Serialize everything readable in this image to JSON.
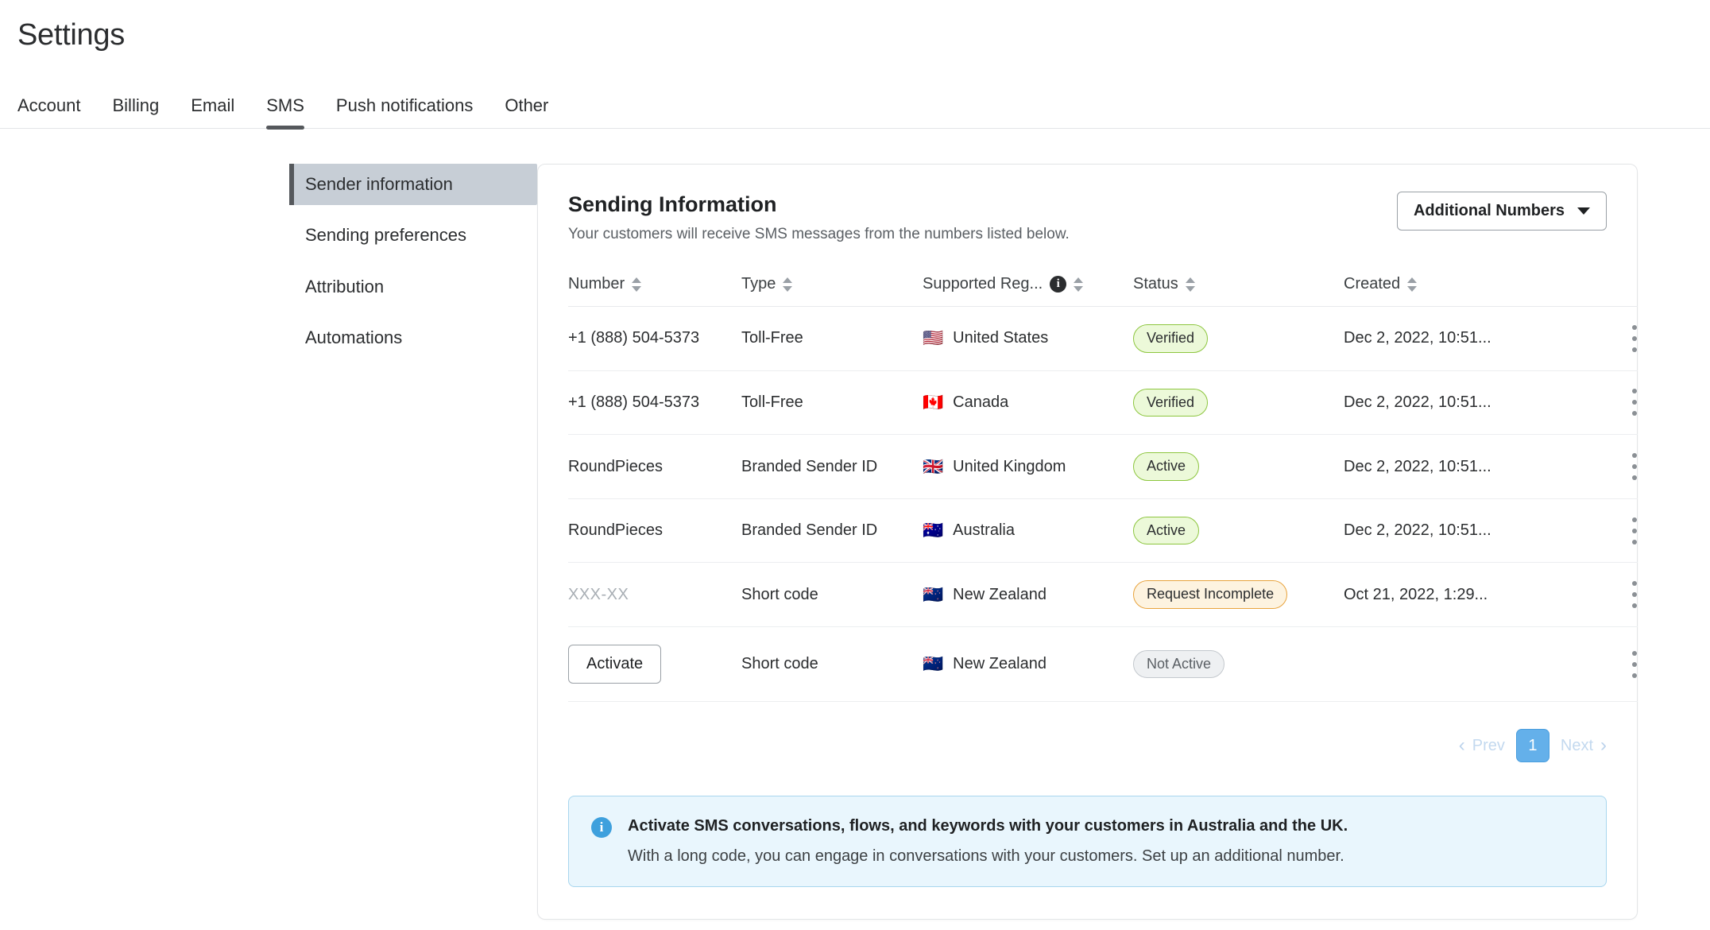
{
  "header": {
    "title": "Settings"
  },
  "tabs": [
    {
      "label": "Account",
      "active": false
    },
    {
      "label": "Billing",
      "active": false
    },
    {
      "label": "Email",
      "active": false
    },
    {
      "label": "SMS",
      "active": true
    },
    {
      "label": "Push notifications",
      "active": false
    },
    {
      "label": "Other",
      "active": false
    }
  ],
  "sidenav": {
    "items": [
      {
        "label": "Sender information",
        "active": true
      },
      {
        "label": "Sending preferences",
        "active": false
      },
      {
        "label": "Attribution",
        "active": false
      },
      {
        "label": "Automations",
        "active": false
      }
    ]
  },
  "card": {
    "title": "Sending Information",
    "subtitle": "Your customers will receive SMS messages from the numbers listed below.",
    "additional_numbers_button": "Additional Numbers",
    "caret_icon": "chevron-down-icon"
  },
  "table": {
    "columns": [
      {
        "label": "Number",
        "sortable": true,
        "info": false
      },
      {
        "label": "Type",
        "sortable": true,
        "info": false
      },
      {
        "label": "Supported Reg...",
        "sortable": true,
        "info": true
      },
      {
        "label": "Status",
        "sortable": true,
        "info": false
      },
      {
        "label": "Created",
        "sortable": true,
        "info": false
      },
      {
        "label": "",
        "sortable": false,
        "info": false
      }
    ],
    "info_icon_char": "i",
    "rows": [
      {
        "number": "+1 (888) 504-5373",
        "number_style": "text",
        "type": "Toll-Free",
        "region": "United States",
        "flag": "🇺🇸",
        "status": "Verified",
        "status_tone": "green",
        "created": "Dec 2, 2022, 10:51..."
      },
      {
        "number": "+1 (888) 504-5373",
        "number_style": "text",
        "type": "Toll-Free",
        "region": "Canada",
        "flag": "🇨🇦",
        "status": "Verified",
        "status_tone": "green",
        "created": "Dec 2, 2022, 10:51..."
      },
      {
        "number": "RoundPieces",
        "number_style": "text",
        "type": "Branded Sender ID",
        "region": "United Kingdom",
        "flag": "🇬🇧",
        "status": "Active",
        "status_tone": "green",
        "created": "Dec 2, 2022, 10:51..."
      },
      {
        "number": "RoundPieces",
        "number_style": "text",
        "type": "Branded Sender ID",
        "region": "Australia",
        "flag": "🇦🇺",
        "status": "Active",
        "status_tone": "green",
        "created": "Dec 2, 2022, 10:51..."
      },
      {
        "number": "XXX-XX",
        "number_style": "muted",
        "type": "Short code",
        "region": "New Zealand",
        "flag": "🇳🇿",
        "status": "Request Incomplete",
        "status_tone": "amber",
        "created": "Oct 21, 2022, 1:29..."
      },
      {
        "number": "Activate",
        "number_style": "button",
        "type": "Short code",
        "region": "New Zealand",
        "flag": "🇳🇿",
        "status": "Not Active",
        "status_tone": "gray",
        "created": ""
      }
    ]
  },
  "pagination": {
    "prev_label": "Prev",
    "next_label": "Next",
    "current_page": "1",
    "prev_icon": "chevron-left-icon",
    "next_icon": "chevron-right-icon"
  },
  "banner": {
    "icon": "info-icon",
    "icon_char": "i",
    "title": "Activate SMS conversations, flows, and keywords with your customers in Australia and the UK.",
    "body": "With a long code, you can engage in conversations with your customers. Set up an additional number."
  },
  "colors": {
    "accent_blue": "#64b0ea",
    "badge_green_border": "#8dc63f",
    "badge_green_bg": "#ecf9d9",
    "badge_amber_border": "#e8a33d",
    "badge_amber_bg": "#fdf3e0",
    "badge_gray_bg": "#eef0f2",
    "banner_bg": "#e9f6fd",
    "banner_border": "#a8d6ee",
    "sidenav_active_bg": "#c7ced6",
    "tab_underline": "#55585c"
  }
}
